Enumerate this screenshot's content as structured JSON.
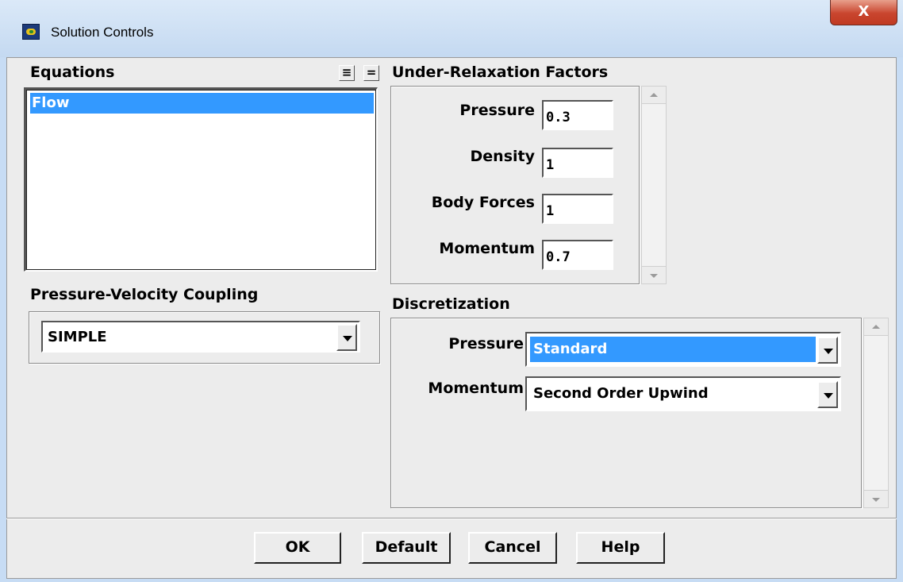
{
  "window": {
    "title": "Solution Controls",
    "close_glyph": "X"
  },
  "equations": {
    "label": "Equations",
    "items": [
      "Flow"
    ],
    "select_all_glyph": "≡",
    "deselect_all_glyph": "="
  },
  "coupling": {
    "label": "Pressure-Velocity Coupling",
    "selected": "SIMPLE"
  },
  "relaxation": {
    "label": "Under-Relaxation Factors",
    "fields": [
      {
        "label": "Pressure",
        "value": "0.3"
      },
      {
        "label": "Density",
        "value": "1"
      },
      {
        "label": "Body Forces",
        "value": "1"
      },
      {
        "label": "Momentum",
        "value": "0.7"
      }
    ]
  },
  "discretization": {
    "label": "Discretization",
    "rows": [
      {
        "label": "Pressure",
        "selected": "Standard"
      },
      {
        "label": "Momentum",
        "selected": "Second Order Upwind"
      }
    ]
  },
  "buttons": {
    "ok": "OK",
    "default": "Default",
    "cancel": "Cancel",
    "help": "Help"
  },
  "colors": {
    "selection": "#3399ff",
    "dialog_bg": "#ececec",
    "close_red": "#c9452e"
  }
}
